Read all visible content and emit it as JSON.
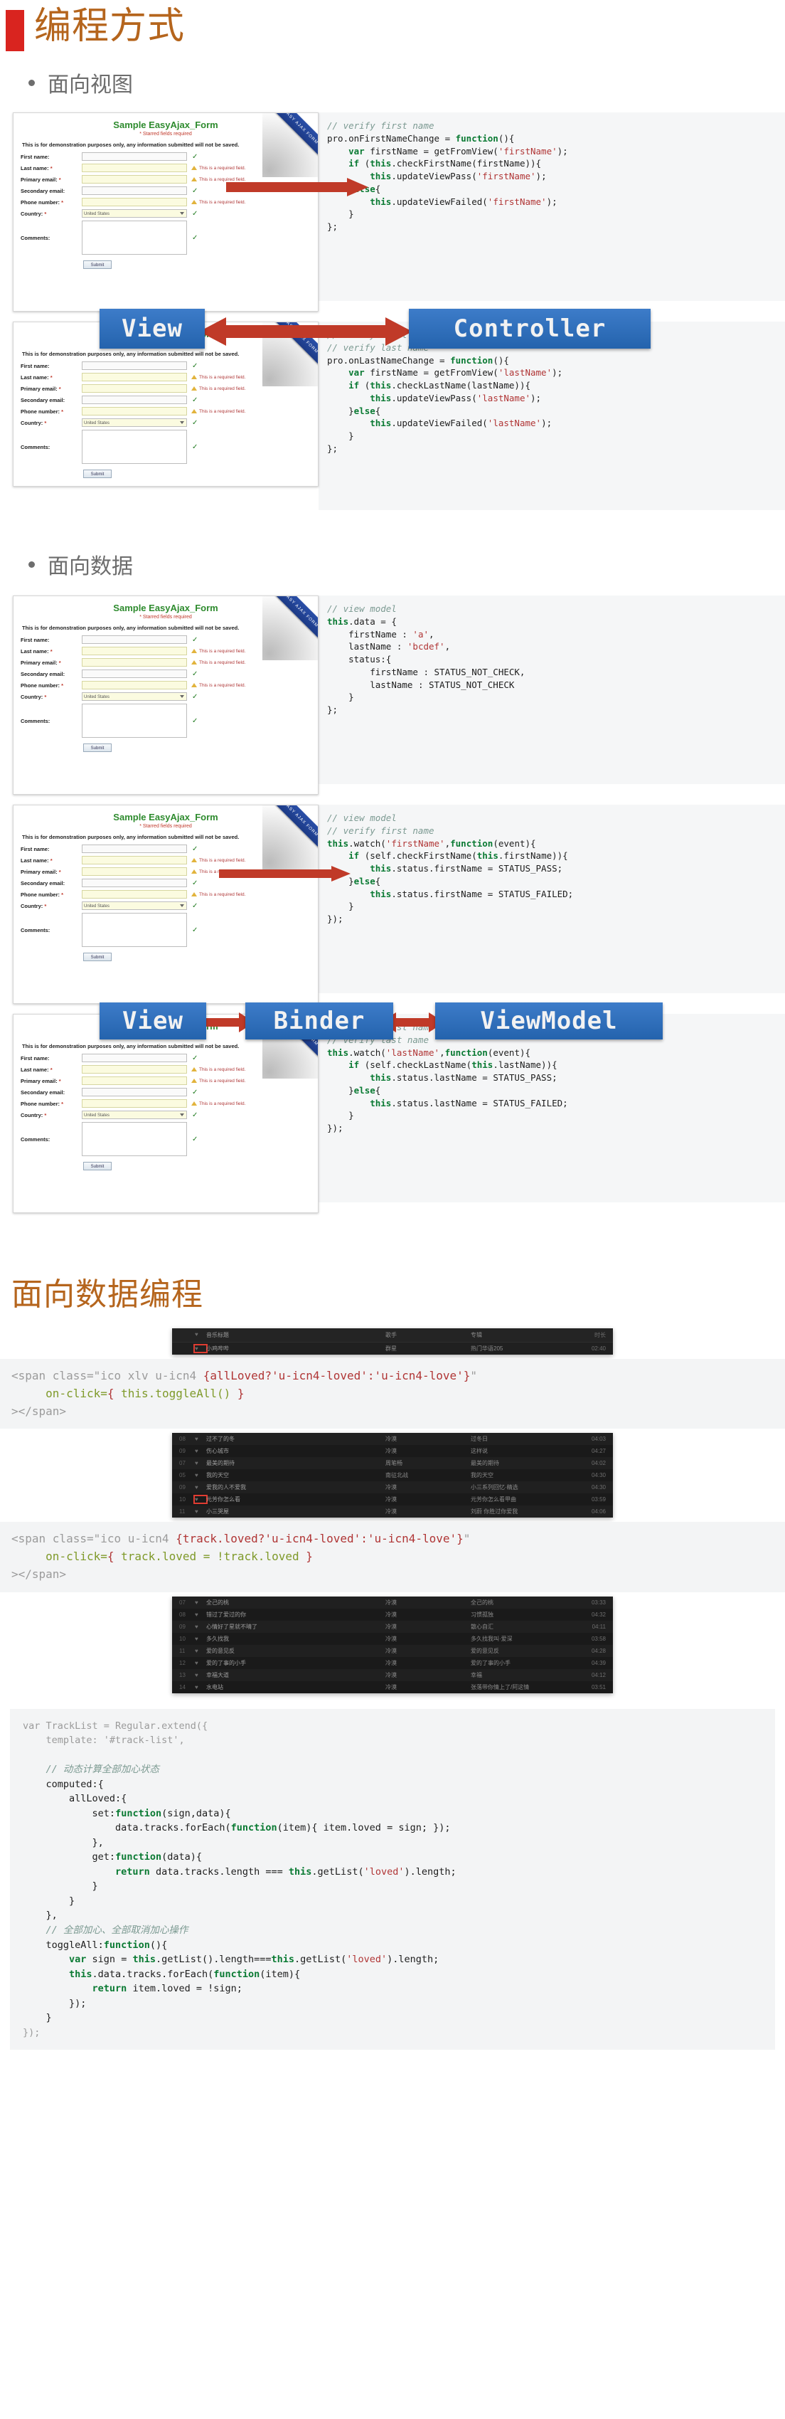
{
  "slide1": {
    "title": "编程方式",
    "bullets": [
      {
        "label": "面向视图"
      },
      {
        "label": "面向数据"
      }
    ],
    "form": {
      "title": "Sample EasyAjax_Form",
      "subtitle": "* Starred fields required",
      "note": "This is for demonstration purposes only, any information submitted will not be saved.",
      "ribbon": "EASY AJAX FORM",
      "required_msg": "This is a required field.",
      "submit_label": "Submit",
      "country_value": "United States",
      "fields": [
        {
          "label": "First name:",
          "required": false,
          "state": "ok"
        },
        {
          "label": "Last name:",
          "required": true,
          "state": "warn"
        },
        {
          "label": "Primary email:",
          "required": true,
          "state": "warn"
        },
        {
          "label": "Secondary email:",
          "required": false,
          "state": "ok"
        },
        {
          "label": "Phone number:",
          "required": true,
          "state": "warn"
        },
        {
          "label": "Country:",
          "required": true,
          "state": "ok"
        },
        {
          "label": "Comments:",
          "required": false,
          "state": "ok"
        }
      ]
    },
    "mvc_tags": {
      "view": "View",
      "controller": "Controller"
    },
    "mvvm_tags": {
      "view": "View",
      "binder": "Binder",
      "viewmodel": "ViewModel"
    },
    "code_blocks": {
      "controller_first": [
        {
          "t": "comment",
          "text": "// verify first name"
        },
        {
          "t": "code",
          "text": "pro.onFirstNameChange = function(){"
        },
        {
          "t": "code",
          "text": "    var firstName = getFromView('firstName');"
        },
        {
          "t": "code",
          "text": "    if (this.checkFirstName(firstName)){"
        },
        {
          "t": "code",
          "text": "        this.updateViewPass('firstName');"
        },
        {
          "t": "code",
          "text": "    }else{"
        },
        {
          "t": "code",
          "text": "        this.updateViewFailed('firstName');"
        },
        {
          "t": "code",
          "text": "    }"
        },
        {
          "t": "code",
          "text": "};"
        }
      ],
      "controller_last": [
        {
          "t": "comment",
          "text": "// verify first name"
        },
        {
          "t": "comment",
          "text": "// verify last name"
        },
        {
          "t": "code",
          "text": "pro.onLastNameChange = function(){"
        },
        {
          "t": "code",
          "text": "    var firstName = getFromView('lastName');"
        },
        {
          "t": "code",
          "text": "    if (this.checkLastName(lastName)){"
        },
        {
          "t": "code",
          "text": "        this.updateViewPass('lastName');"
        },
        {
          "t": "code",
          "text": "    }else{"
        },
        {
          "t": "code",
          "text": "        this.updateViewFailed('lastName');"
        },
        {
          "t": "code",
          "text": "    }"
        },
        {
          "t": "code",
          "text": "};"
        }
      ],
      "view_model": [
        {
          "t": "comment",
          "text": "// view model"
        },
        {
          "t": "code",
          "text": "this.data = {"
        },
        {
          "t": "code",
          "text": "    firstName : 'a',"
        },
        {
          "t": "code",
          "text": "    lastName : 'bcdef',"
        },
        {
          "t": "code",
          "text": "    status:{"
        },
        {
          "t": "code",
          "text": "        firstName : STATUS_NOT_CHECK,"
        },
        {
          "t": "code",
          "text": "        lastName : STATUS_NOT_CHECK"
        },
        {
          "t": "code",
          "text": "    }"
        },
        {
          "t": "code",
          "text": "};"
        }
      ],
      "watch_first": [
        {
          "t": "comment",
          "text": "// view model"
        },
        {
          "t": "comment",
          "text": "// verify first name"
        },
        {
          "t": "code",
          "text": "this.watch('firstName',function(event){"
        },
        {
          "t": "code",
          "text": "    if (self.checkFirstName(this.firstName)){"
        },
        {
          "t": "code",
          "text": "        this.status.firstName = STATUS_PASS;"
        },
        {
          "t": "code",
          "text": "    }else{"
        },
        {
          "t": "code",
          "text": "        this.status.firstName = STATUS_FAILED;"
        },
        {
          "t": "code",
          "text": "    }"
        },
        {
          "t": "code",
          "text": "});"
        }
      ],
      "watch_last": [
        {
          "t": "comment",
          "text": "// verify first name"
        },
        {
          "t": "comment",
          "text": "// verify last name"
        },
        {
          "t": "code",
          "text": "this.watch('lastName',function(event){"
        },
        {
          "t": "code",
          "text": "    if (self.checkLastName(this.lastName)){"
        },
        {
          "t": "code",
          "text": "        this.status.lastName = STATUS_PASS;"
        },
        {
          "t": "code",
          "text": "    }else{"
        },
        {
          "t": "code",
          "text": "        this.status.lastName = STATUS_FAILED;"
        },
        {
          "t": "code",
          "text": "    }"
        },
        {
          "t": "code",
          "text": "});"
        }
      ]
    }
  },
  "slide2": {
    "title": "面向数据编程",
    "player": {
      "headers": [
        "音乐标题",
        "歌手",
        "专辑",
        "时长"
      ],
      "rows": [
        {
          "idx": "",
          "title": "小鸡哔哔",
          "artist": "群星",
          "album": "热门华语205",
          "time": "02:40"
        },
        {
          "idx": "08",
          "title": "过不了的冬",
          "artist": "冷漠",
          "album": "过冬日",
          "time": "04:03"
        },
        {
          "idx": "09",
          "title": "伤心城市",
          "artist": "冷漠",
          "album": "这样说",
          "time": "04:27"
        },
        {
          "idx": "07",
          "title": "最美的期待",
          "artist": "周笔畅",
          "album": "最美的期待",
          "time": "04:02"
        },
        {
          "idx": "05",
          "title": "我的天空",
          "artist": "南征北战",
          "album": "我的天空",
          "time": "04:30"
        },
        {
          "idx": "09",
          "title": "爱我的人不爱我",
          "artist": "冷漠",
          "album": "小三系列回忆·精选",
          "time": "04:30"
        },
        {
          "idx": "10",
          "title": "元芳你怎么看",
          "artist": "冷漠",
          "album": "元芳你怎么看甲曲",
          "time": "03:59"
        },
        {
          "idx": "11",
          "title": "小三哭屋",
          "artist": "冷漠",
          "album": "刘蔚 你胜过你爱我",
          "time": "04:06"
        },
        {
          "idx": "07",
          "title": "全己的桃",
          "artist": "冷漠",
          "album": "全己的桃",
          "time": "03:33"
        },
        {
          "idx": "08",
          "title": "错过了爱过的你",
          "artist": "冷漠",
          "album": "习惯孤独",
          "time": "04:32"
        },
        {
          "idx": "09",
          "title": "心情好了星就不晴了",
          "artist": "冷漠",
          "album": "散心自汇",
          "time": "04:11"
        },
        {
          "idx": "10",
          "title": "多久找我",
          "artist": "冷漠",
          "album": "多久找我叫·爱深",
          "time": "03:58"
        },
        {
          "idx": "11",
          "title": "爱的意见反",
          "artist": "冷漠",
          "album": "爱的意见反",
          "time": "04:28"
        },
        {
          "idx": "12",
          "title": "爱的了事的小手",
          "artist": "冷漠",
          "album": "爱的了事的小手",
          "time": "04:39"
        },
        {
          "idx": "13",
          "title": "幸福大道",
          "artist": "冷漠",
          "album": "幸福",
          "time": "04:12"
        },
        {
          "idx": "14",
          "title": "水电站",
          "artist": "冷漠",
          "album": "张落带你情上了/阿这情",
          "time": "03:51"
        }
      ]
    },
    "snippet_toggle_all": [
      {
        "t": "dim",
        "text": "<span class=\"ico xlv u-icn4 "
      },
      {
        "t": "str",
        "text": "{allLoved?'u-icn4-loved':'u-icn4-love'}"
      },
      {
        "t": "dim",
        "text": "\""
      }
    ],
    "snippet_toggle_all_lines": [
      "<span class=\"ico xlv u-icn4 {allLoved?'u-icn4-loved':'u-icn4-love'}\"",
      "     on-click={ this.toggleAll() }",
      "></span>"
    ],
    "snippet_toggle_one_lines": [
      "<span class=\"ico u-icn4 {track.loved?'u-icn4-loved':'u-icn4-love'}\"",
      "     on-click={ track.loved = !track.loved }",
      "></span>"
    ],
    "tracklist_code": [
      {
        "t": "dim",
        "text": "var TrackList = Regular.extend({"
      },
      {
        "t": "dim",
        "text": "    template: '#track-list',"
      },
      {
        "t": "blank",
        "text": ""
      },
      {
        "t": "cmt",
        "text": "    // 动态计算全部加心状态"
      },
      {
        "t": "code",
        "text": "    computed:{"
      },
      {
        "t": "code",
        "text": "        allLoved:{"
      },
      {
        "t": "code",
        "text": "            set:function(sign,data){"
      },
      {
        "t": "code",
        "text": "                data.tracks.forEach(function(item){ item.loved = sign; });"
      },
      {
        "t": "code",
        "text": "            },"
      },
      {
        "t": "code",
        "text": "            get:function(data){"
      },
      {
        "t": "code",
        "text": "                return data.tracks.length === this.getList('loved').length;"
      },
      {
        "t": "code",
        "text": "            }"
      },
      {
        "t": "code",
        "text": "        }"
      },
      {
        "t": "code",
        "text": "    },"
      },
      {
        "t": "cmt",
        "text": "    // 全部加心、全部取消加心操作"
      },
      {
        "t": "code",
        "text": "    toggleAll:function(){"
      },
      {
        "t": "code",
        "text": "        var sign = this.getList().length===this.getList('loved').length;"
      },
      {
        "t": "code",
        "text": "        this.data.tracks.forEach(function(item){"
      },
      {
        "t": "code",
        "text": "            return item.loved = !sign;"
      },
      {
        "t": "code",
        "text": "        });"
      },
      {
        "t": "code",
        "text": "    }"
      },
      {
        "t": "dim",
        "text": "});"
      }
    ]
  },
  "colors": {
    "heading": "#b5651d",
    "marker_red": "#d9241f",
    "tag_blue": "#2463ad",
    "arrow_red": "#c03a28",
    "comment_green": "#7c9a92",
    "string_red": "#b03535",
    "keyword_green": "#0a7a33"
  }
}
